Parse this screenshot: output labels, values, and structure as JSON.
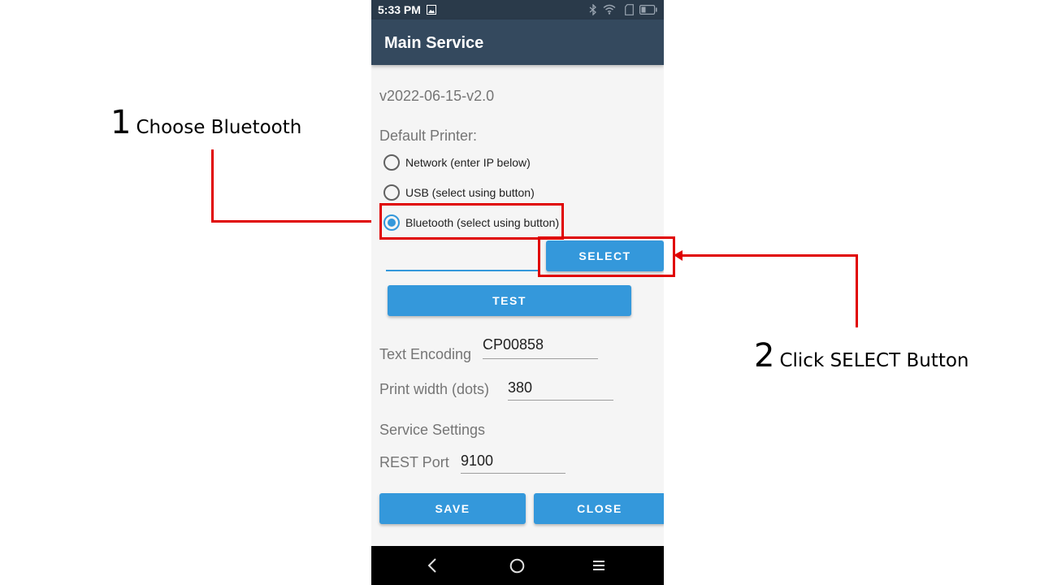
{
  "annotations": {
    "step1": {
      "number": "1",
      "text": "Choose Bluetooth"
    },
    "step2": {
      "number": "2",
      "text": "Click SELECT Button"
    },
    "color": "#e00000"
  },
  "status_bar": {
    "time": "5:33 PM"
  },
  "app_bar": {
    "title": "Main Service"
  },
  "main": {
    "version": "v2022-06-15-v2.0",
    "default_printer_label": "Default Printer:",
    "radio_options": [
      {
        "label": "Network (enter IP below)",
        "checked": false
      },
      {
        "label": "USB (select using button)",
        "checked": false
      },
      {
        "label": "Bluetooth (select using button)",
        "checked": true
      }
    ],
    "device_value": "",
    "select_label": "SELECT",
    "test_label": "TEST",
    "text_encoding_label": "Text Encoding",
    "text_encoding_value": "CP00858",
    "print_width_label": "Print width (dots)",
    "print_width_value": "380",
    "service_settings_label": "Service Settings",
    "rest_port_label": "REST Port",
    "rest_port_value": "9100",
    "save_label": "SAVE",
    "close_label": "CLOSE"
  },
  "colors": {
    "accent": "#3498db",
    "app_bar": "#34495e",
    "status_bar": "#2a3a4a"
  }
}
